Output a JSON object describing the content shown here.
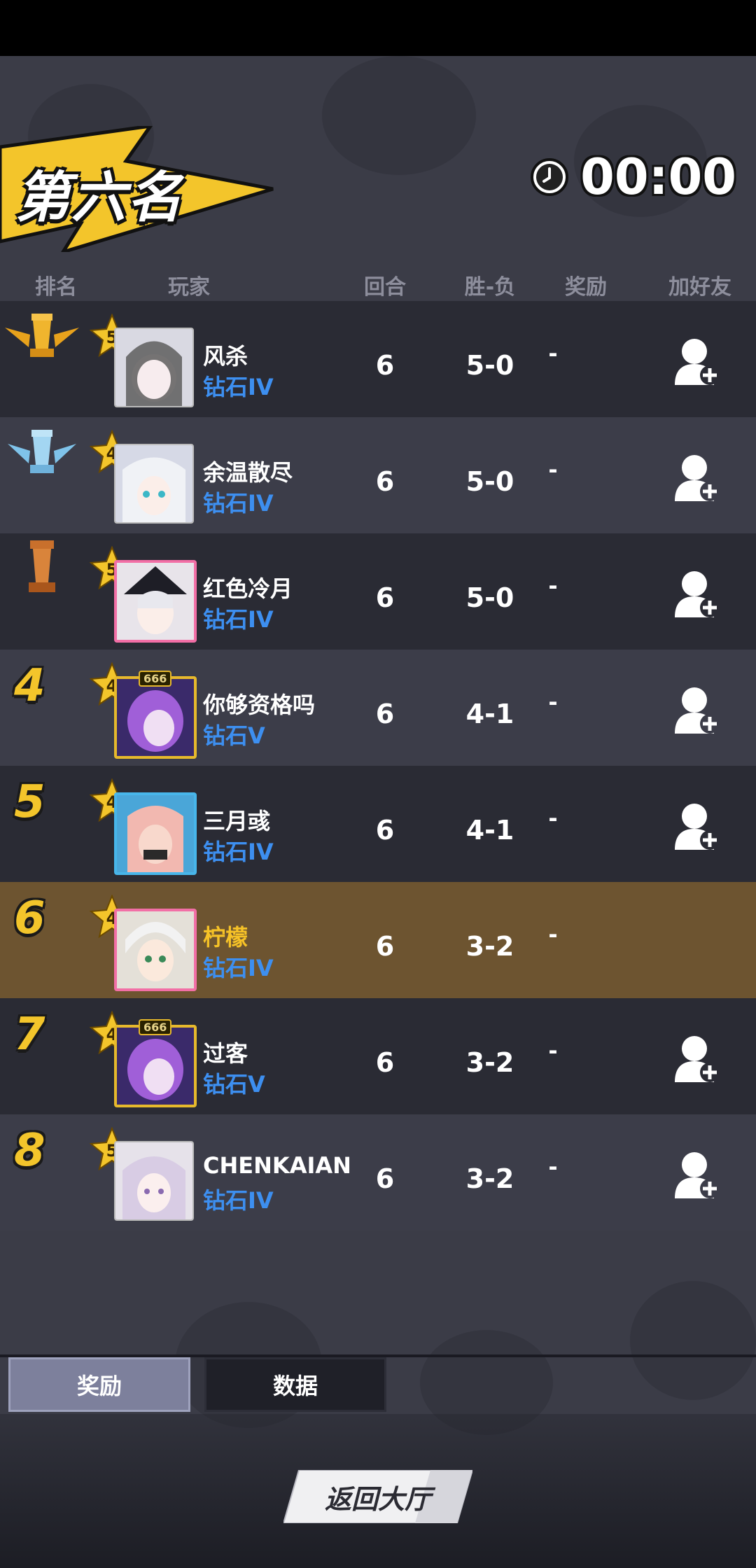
{
  "title": "第六名",
  "timer": "00:00",
  "headers": {
    "rank": "排名",
    "player": "玩家",
    "rounds": "回合",
    "win_loss": "胜-负",
    "reward": "奖励",
    "add_friend": "加好友"
  },
  "rows": [
    {
      "rank": "1",
      "trophy": "gold-trophy",
      "level": "5",
      "name": "风杀",
      "tier": "钻石IV",
      "rounds": "6",
      "win_loss": "5-0",
      "reward": "-"
    },
    {
      "rank": "2",
      "trophy": "silver-trophy",
      "level": "4",
      "name": "余温散尽",
      "tier": "钻石IV",
      "rounds": "6",
      "win_loss": "5-0",
      "reward": "-"
    },
    {
      "rank": "3",
      "trophy": "bronze-trophy",
      "level": "5",
      "name": "红色冷月",
      "tier": "钻石IV",
      "rounds": "6",
      "win_loss": "5-0",
      "reward": "-"
    },
    {
      "rank": "4",
      "level": "4",
      "badge": "666",
      "name": "你够资格吗",
      "tier": "钻石V",
      "rounds": "6",
      "win_loss": "4-1",
      "reward": "-"
    },
    {
      "rank": "5",
      "level": "4",
      "name": "三月彧",
      "tier": "钻石IV",
      "rounds": "6",
      "win_loss": "4-1",
      "reward": "-"
    },
    {
      "rank": "6",
      "level": "4",
      "name": "柠檬",
      "tier": "钻石IV",
      "rounds": "6",
      "win_loss": "3-2",
      "reward": "-",
      "is_self": true
    },
    {
      "rank": "7",
      "level": "4",
      "badge": "666",
      "name": "过客",
      "tier": "钻石V",
      "rounds": "6",
      "win_loss": "3-2",
      "reward": "-"
    },
    {
      "rank": "8",
      "level": "5",
      "name": "CHENKAIAN",
      "tier": "钻石IV",
      "rounds": "6",
      "win_loss": "3-2",
      "reward": "-"
    }
  ],
  "tabs": {
    "reward": "奖励",
    "data": "数据"
  },
  "back_button": "返回大厅",
  "colors": {
    "accent_yellow": "#f3c52b",
    "tier_blue": "#3d8ff0",
    "self_row": "#6d5430"
  },
  "icons": [
    "clock-icon",
    "gold-trophy-icon",
    "silver-trophy-icon",
    "bronze-trophy-icon",
    "level-star-icon",
    "add-friend-icon"
  ]
}
